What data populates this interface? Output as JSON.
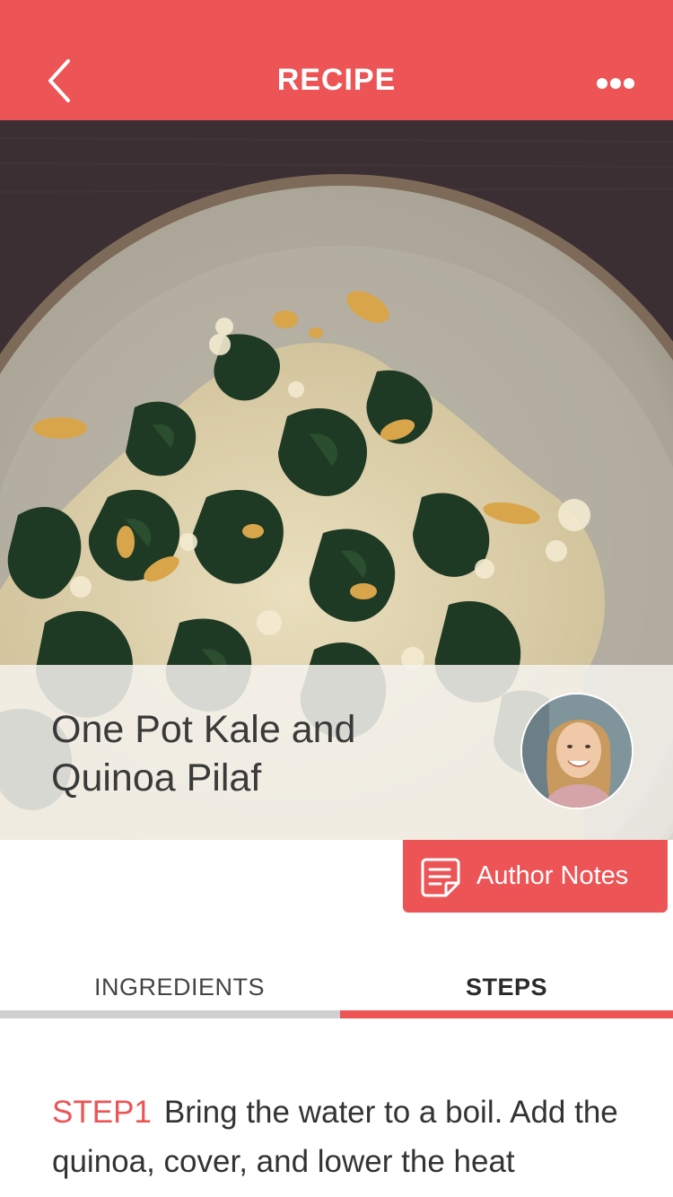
{
  "header": {
    "title": "RECIPE",
    "background": "#EC5456",
    "back_icon": "chevron-left-icon",
    "more_icon": "more-dots-icon"
  },
  "recipe": {
    "title": "One Pot Kale and Quinoa Pilaf",
    "image": "kale-quinoa-plate-photo",
    "author_avatar": "author-avatar-photo"
  },
  "author_notes": {
    "label": "Author Notes",
    "icon": "notes-icon"
  },
  "tabs": [
    {
      "label": "INGREDIENTS",
      "active": false
    },
    {
      "label": "STEPS",
      "active": true
    }
  ],
  "steps": [
    {
      "label": "STEP1",
      "text": "Bring the water to a boil. Add the quinoa, cover, and lower the heat"
    }
  ],
  "colors": {
    "accent": "#EC5456",
    "tab_inactive_bar": "#cfcfcf"
  }
}
